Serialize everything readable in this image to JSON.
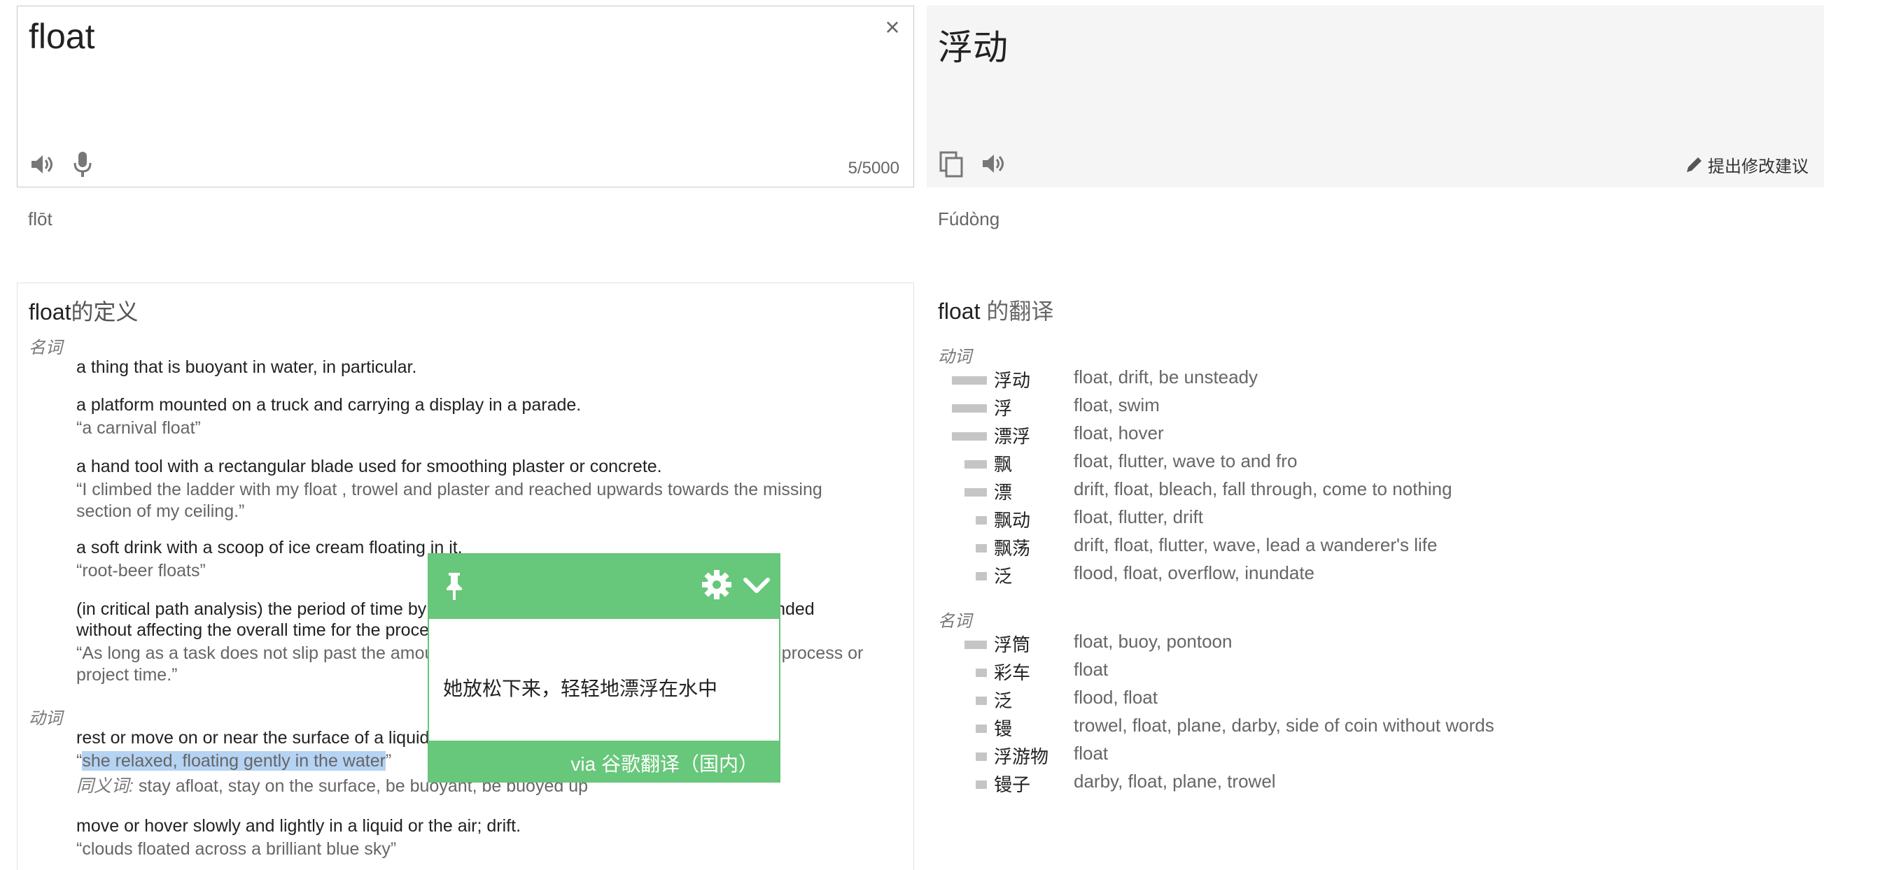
{
  "source": {
    "text": "float",
    "clear_label": "×",
    "char_count": "5/5000",
    "transliteration": "flōt"
  },
  "target": {
    "text": "浮动",
    "suggest_label": "提出修改建议",
    "transliteration": "Fúdòng"
  },
  "definitions": {
    "title_word": "float",
    "title_suffix": "的定义",
    "noun": {
      "pos": "名词",
      "entries": [
        {
          "gloss": "a thing that is buoyant in water, in particular."
        },
        {
          "gloss": "a platform mounted on a truck and carrying a display in a parade.",
          "example": "“a carnival float”"
        },
        {
          "gloss": "a hand tool with a rectangular blade used for smoothing plaster or concrete.",
          "example": "“I climbed the ladder with my float , trowel and plaster and reached upwards towards the missing section of my ceiling.”"
        },
        {
          "gloss": "a soft drink with a scoop of ice cream floating in it.",
          "example": "“root-beer floats”"
        },
        {
          "gloss": "(in critical path analysis) the period of time by which the duration of an activity may be extended",
          "gloss2": "without affecting the overall time for the process.",
          "example": "“As long as a task does not slip past the amount of float available, it won't affect the overall process or project time.”"
        }
      ]
    },
    "verb": {
      "pos": "动词",
      "entries": [
        {
          "gloss": "rest or move on or near the surface of a liquid without sinking.",
          "example_open": "“",
          "example_highlight": "she relaxed, floating gently in the water",
          "example_close": "”",
          "syn_label": "同义词:",
          "synonyms": "stay afloat, stay on the surface, be buoyant, be buoyed up"
        },
        {
          "gloss": "move or hover slowly and lightly in a liquid or the air; drift.",
          "example": "“clouds floated across a brilliant blue sky”"
        }
      ]
    }
  },
  "translations": {
    "title_word": "float",
    "title_suffix": " 的翻译",
    "verb": {
      "pos": "动词",
      "rows": [
        {
          "word": "浮动",
          "meanings": "float, drift, be unsteady",
          "freq": 3
        },
        {
          "word": "浮",
          "meanings": "float, swim",
          "freq": 3
        },
        {
          "word": "漂浮",
          "meanings": "float, hover",
          "freq": 3
        },
        {
          "word": "飘",
          "meanings": "float, flutter, wave to and fro",
          "freq": 2
        },
        {
          "word": "漂",
          "meanings": "drift, float, bleach, fall through, come to nothing",
          "freq": 2
        },
        {
          "word": "飘动",
          "meanings": "float, flutter, drift",
          "freq": 1
        },
        {
          "word": "飘荡",
          "meanings": "drift, float, flutter, wave, lead a wanderer's life",
          "freq": 1
        },
        {
          "word": "泛",
          "meanings": "flood, float, overflow, inundate",
          "freq": 1
        }
      ]
    },
    "noun": {
      "pos": "名词",
      "rows": [
        {
          "word": "浮筒",
          "meanings": "float, buoy, pontoon",
          "freq": 2
        },
        {
          "word": "彩车",
          "meanings": "float",
          "freq": 1
        },
        {
          "word": "泛",
          "meanings": "flood, float",
          "freq": 1
        },
        {
          "word": "镘",
          "meanings": "trowel, float, plane, darby, side of coin without words",
          "freq": 1
        },
        {
          "word": "浮游物",
          "meanings": "float",
          "freq": 1
        },
        {
          "word": "镘子",
          "meanings": "darby, float, plane, trowel",
          "freq": 1
        }
      ]
    }
  },
  "popup": {
    "text": "她放松下来，轻轻地漂浮在水中",
    "source": "via 谷歌翻译（国内）",
    "accent": "#67c77a"
  },
  "icons": [
    "speaker-icon",
    "microphone-icon",
    "close-icon",
    "copy-icon",
    "pencil-icon",
    "pin-icon",
    "gear-icon",
    "chevron-down-icon"
  ]
}
